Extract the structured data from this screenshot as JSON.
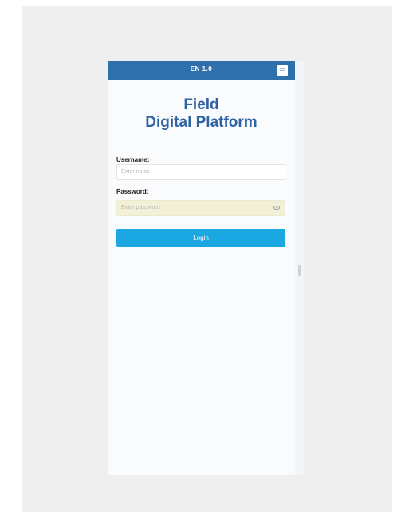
{
  "header": {
    "version": "EN 1.0",
    "menu_icon": "menu-icon"
  },
  "title": {
    "line1": "Field",
    "line2": "Digital Platform"
  },
  "form": {
    "username_label": "Username:",
    "username_placeholder": "Enter name",
    "password_label": "Password:",
    "password_placeholder": "Enter password",
    "show_password_icon": "eye-icon",
    "login_label": "Login"
  },
  "colors": {
    "header": "#2f6fab",
    "title": "#2f63a3",
    "login_button": "#1ba7e2",
    "password_field_autofill": "#f2f0d6"
  }
}
